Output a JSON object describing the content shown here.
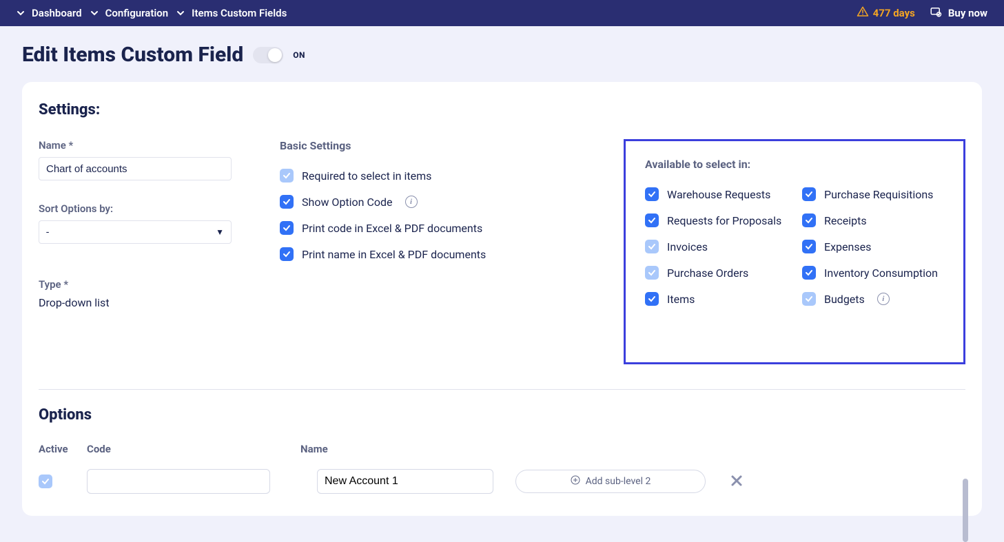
{
  "breadcrumb": [
    "Dashboard",
    "Configuration",
    "Items Custom Fields"
  ],
  "warning_days": "477 days",
  "buy_now": "Buy now",
  "page_title": "Edit Items Custom Field",
  "toggle_label": "ON",
  "settings_heading": "Settings:",
  "name_label": "Name *",
  "name_value": "Chart of accounts",
  "sort_label": "Sort Options by:",
  "sort_value": "-",
  "type_label": "Type *",
  "type_value": "Drop-down list",
  "basic_settings_heading": "Basic Settings",
  "basic": [
    {
      "label": "Required to select in items",
      "checked": true,
      "disabled": true,
      "info": false
    },
    {
      "label": "Show Option Code",
      "checked": true,
      "disabled": false,
      "info": true
    },
    {
      "label": "Print code in Excel & PDF documents",
      "checked": true,
      "disabled": false,
      "info": false
    },
    {
      "label": "Print name in Excel & PDF documents",
      "checked": true,
      "disabled": false,
      "info": false
    }
  ],
  "available_heading": "Available to select in:",
  "available_left": [
    {
      "label": "Warehouse Requests",
      "checked": true,
      "disabled": false,
      "info": false
    },
    {
      "label": "Requests for Proposals",
      "checked": true,
      "disabled": false,
      "info": false
    },
    {
      "label": "Invoices",
      "checked": true,
      "disabled": true,
      "info": false
    },
    {
      "label": "Purchase Orders",
      "checked": true,
      "disabled": true,
      "info": false
    },
    {
      "label": "Items",
      "checked": true,
      "disabled": false,
      "info": false
    }
  ],
  "available_right": [
    {
      "label": "Purchase Requisitions",
      "checked": true,
      "disabled": false,
      "info": false
    },
    {
      "label": "Receipts",
      "checked": true,
      "disabled": false,
      "info": false
    },
    {
      "label": "Expenses",
      "checked": true,
      "disabled": false,
      "info": false
    },
    {
      "label": "Inventory Consumption",
      "checked": true,
      "disabled": false,
      "info": false
    },
    {
      "label": "Budgets",
      "checked": true,
      "disabled": true,
      "info": true
    }
  ],
  "options_heading": "Options",
  "options_columns": {
    "active": "Active",
    "code": "Code",
    "name": "Name"
  },
  "options_row": {
    "active": true,
    "code": "",
    "name": "New Account 1"
  },
  "add_sublevel": "Add sub-level 2"
}
